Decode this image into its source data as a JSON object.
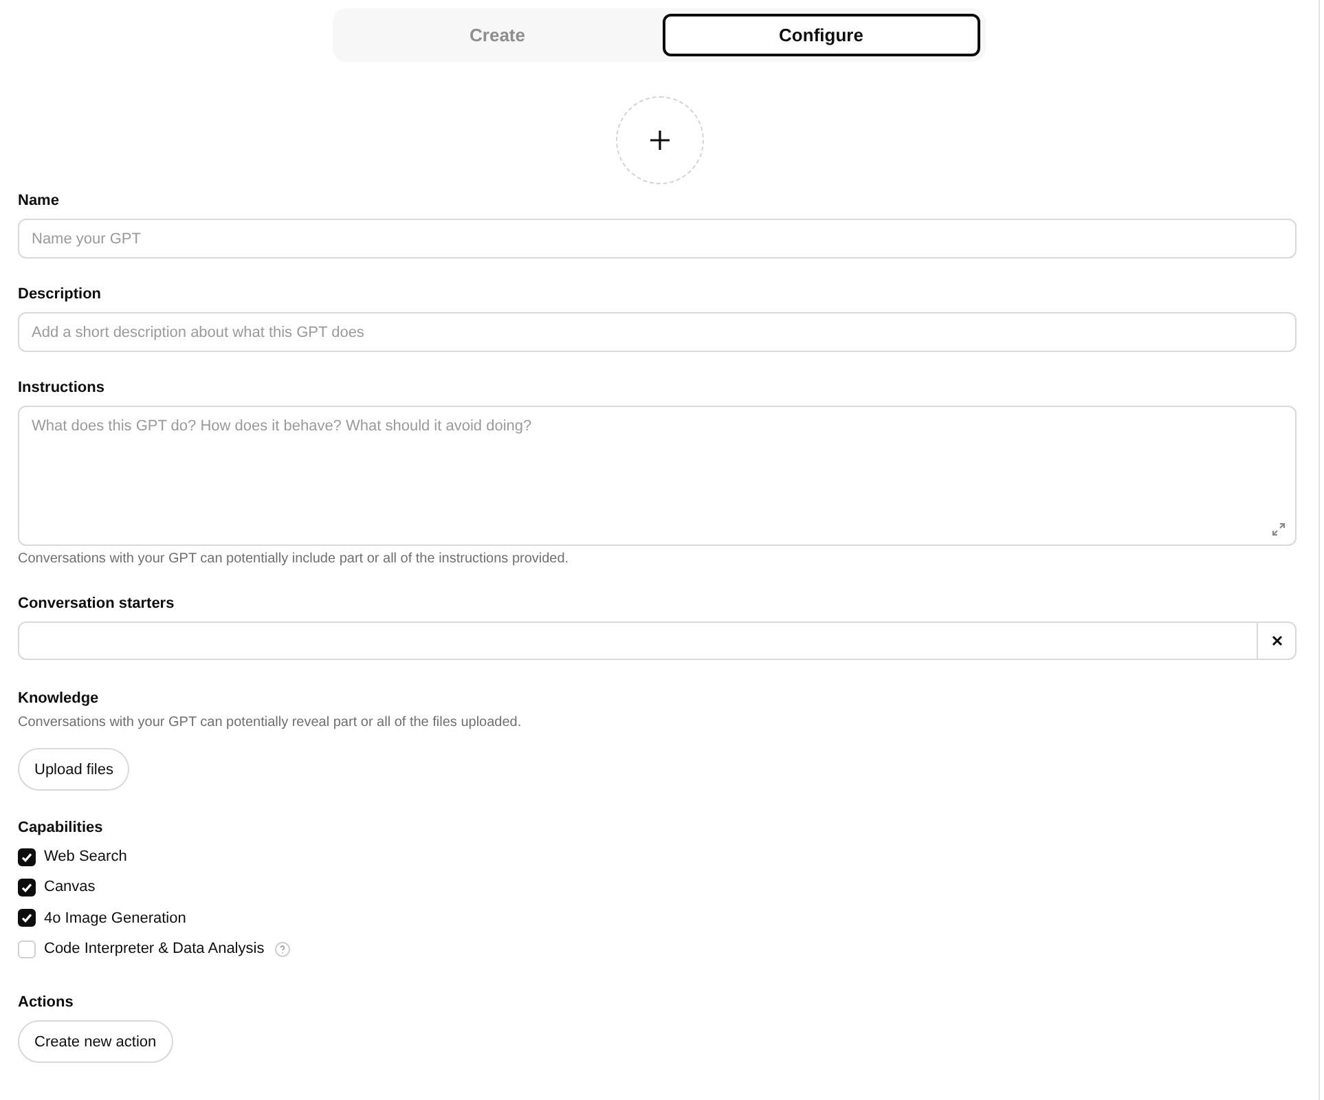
{
  "tabs": [
    {
      "label": "Create",
      "selected": false
    },
    {
      "label": "Configure",
      "selected": true
    }
  ],
  "fields": [
    {
      "label": "Name",
      "kind": "input",
      "placeholder": "Name your GPT"
    },
    {
      "label": "Description",
      "kind": "input",
      "placeholder": "Add a short description about what this GPT does"
    },
    {
      "label": "Instructions",
      "kind": "textarea",
      "placeholder": "What does this GPT do? How does it behave? What should it avoid doing?",
      "hint": "Conversations with your GPT can potentially include part or all of the instructions provided."
    },
    {
      "label": "Conversation starters",
      "kind": "starter"
    }
  ],
  "knowledge": {
    "label": "Knowledge",
    "hint": "Conversations with your GPT can potentially reveal part or all of the files uploaded.",
    "button": "Upload files"
  },
  "capabilities": {
    "label": "Capabilities",
    "items": [
      {
        "label": "Web Search",
        "checked": true,
        "help": false
      },
      {
        "label": "Canvas",
        "checked": true,
        "help": false
      },
      {
        "label": "4o Image Generation",
        "checked": true,
        "help": false
      },
      {
        "label": "Code Interpreter & Data Analysis",
        "checked": false,
        "help": true
      }
    ]
  },
  "actions": {
    "label": "Actions",
    "button": "Create new action"
  }
}
